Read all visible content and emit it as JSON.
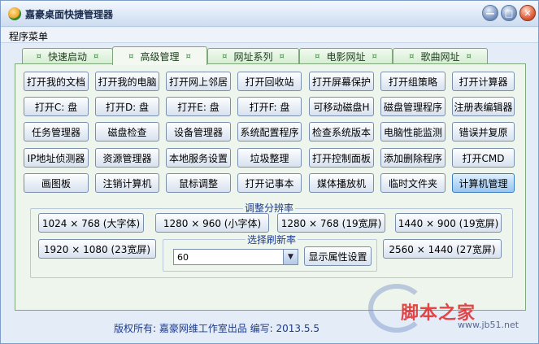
{
  "window": {
    "title": "嘉豪桌面快捷管理器"
  },
  "menu": {
    "items": [
      "程序菜单"
    ]
  },
  "tabs": [
    {
      "label": "快速启动",
      "active": false
    },
    {
      "label": "高级管理",
      "active": true
    },
    {
      "label": "网址系列",
      "active": false
    },
    {
      "label": "电影网址",
      "active": false
    },
    {
      "label": "歌曲网址",
      "active": false
    }
  ],
  "tab_marker": "¤",
  "button_rows": [
    [
      "打开我的文档",
      "打开我的电脑",
      "打开网上邻居",
      "打开回收站",
      "打开屏幕保护",
      "打开组策略",
      "打开计算器"
    ],
    [
      "打开C: 盘",
      "打开D: 盘",
      "打开E: 盘",
      "打开F: 盘",
      "可移动磁盘H",
      "磁盘管理程序",
      "注册表编辑器"
    ],
    [
      "任务管理器",
      "磁盘检查",
      "设备管理器",
      "系统配置程序",
      "检查系统版本",
      "电脑性能监测",
      "错误并复原"
    ],
    [
      "IP地址侦测器",
      "资源管理器",
      "本地服务设置",
      "垃圾整理",
      "打开控制面板",
      "添加删除程序",
      "打开CMD"
    ],
    [
      "画图板",
      "注销计算机",
      "鼠标调整",
      "打开记事本",
      "媒体播放机",
      "临时文件夹",
      "计算机管理"
    ]
  ],
  "selected_button": "计算机管理",
  "resolution": {
    "title": "调整分辨率",
    "options": [
      "1024 × 768 (大字体)",
      "1280 × 960 (小字体)",
      "1280 × 768 (19宽屏)",
      "1440 × 900 (19宽屏)",
      "1920 × 1080 (23宽屏)",
      "2560 × 1440 (27宽屏)"
    ]
  },
  "refresh": {
    "title": "选择刷新率",
    "value": "60",
    "button": "显示属性设置"
  },
  "footer": {
    "text": "版权所有: 嘉豪网维工作室出品   编写: 2013.5.5"
  },
  "watermark": {
    "text": "脚本之家",
    "url": "www.jb51.net"
  }
}
